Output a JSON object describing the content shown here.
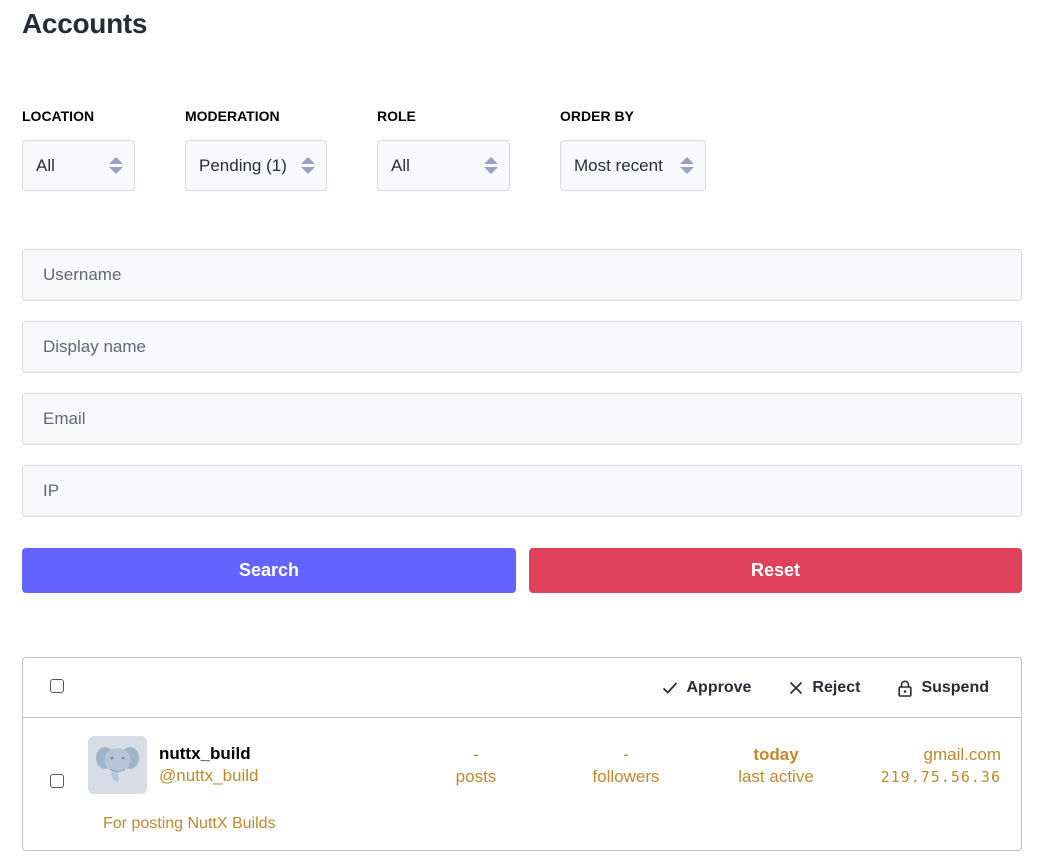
{
  "page": {
    "title": "Accounts"
  },
  "filters": [
    {
      "key": "location",
      "label": "LOCATION",
      "value": "All"
    },
    {
      "key": "moderation",
      "label": "MODERATION",
      "value": "Pending (1)"
    },
    {
      "key": "role",
      "label": "ROLE",
      "value": "All"
    },
    {
      "key": "order",
      "label": "ORDER BY",
      "value": "Most recent"
    }
  ],
  "search": {
    "username_placeholder": "Username",
    "display_name_placeholder": "Display name",
    "email_placeholder": "Email",
    "ip_placeholder": "IP",
    "search_label": "Search",
    "reset_label": "Reset"
  },
  "batch": {
    "approve_label": "Approve",
    "reject_label": "Reject",
    "suspend_label": "Suspend"
  },
  "accounts": [
    {
      "display_name": "nuttx_build",
      "handle": "@nuttx_build",
      "posts_value": "-",
      "posts_label": "posts",
      "followers_value": "-",
      "followers_label": "followers",
      "last_active_value": "today",
      "last_active_label": "last active",
      "email_domain": "gmail.com",
      "ip": "219.75.56.36",
      "note": "For posting NuttX Builds"
    }
  ],
  "colors": {
    "accent": "#6364ff",
    "danger": "#df405a",
    "warning_text": "#c2882e",
    "avatar_bg": "#d6dde6"
  },
  "icons": {
    "approve": "check-icon",
    "reject": "close-icon",
    "suspend": "lock-icon",
    "avatar": "mastodon-elephant-icon"
  }
}
